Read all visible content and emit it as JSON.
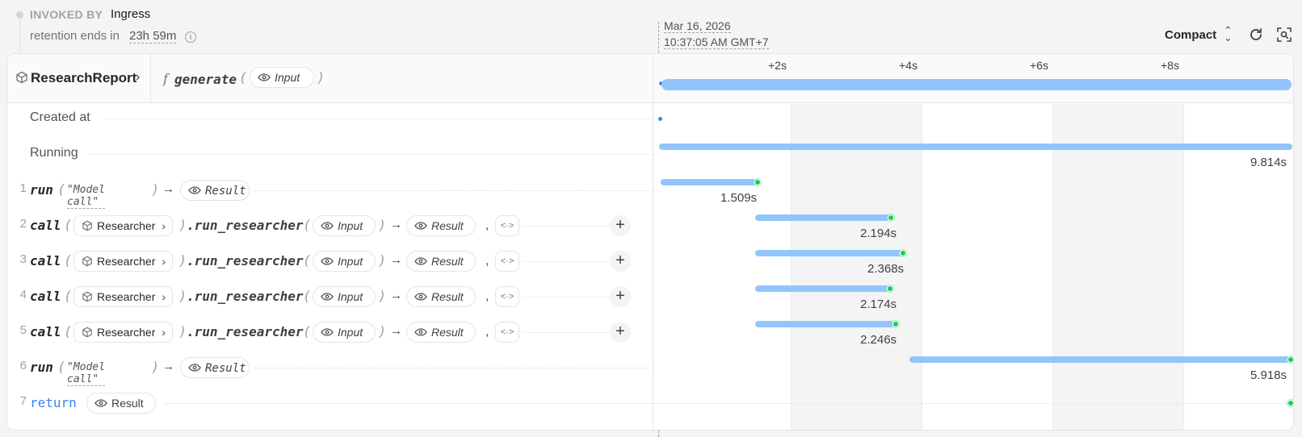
{
  "header": {
    "invoked_by_label": "INVOKED BY",
    "invoked_by_value": "Ingress",
    "retention_label": "retention ends in",
    "retention_value": "23h 59m",
    "date": "Mar 16, 2026",
    "time": "10:37:05 AM GMT+7",
    "view_mode": "Compact"
  },
  "invocation": {
    "service": "ResearchReport",
    "handler": "generate",
    "input_label": "Input"
  },
  "timeline": {
    "ticks": [
      "+2s",
      "+4s",
      "+6s",
      "+8s"
    ]
  },
  "rows": {
    "created_label": "Created at",
    "running_label": "Running",
    "running_duration": "9.814s"
  },
  "entries": [
    {
      "num": "1",
      "kw": "run",
      "arg": "\"Model call\"",
      "result": "Result",
      "duration": "1.509s"
    },
    {
      "num": "2",
      "kw": "call",
      "target": "Researcher",
      "method": ".run_researcher",
      "input": "Input",
      "result": "Result",
      "duration": "2.194s"
    },
    {
      "num": "3",
      "kw": "call",
      "target": "Researcher",
      "method": ".run_researcher",
      "input": "Input",
      "result": "Result",
      "duration": "2.368s"
    },
    {
      "num": "4",
      "kw": "call",
      "target": "Researcher",
      "method": ".run_researcher",
      "input": "Input",
      "result": "Result",
      "duration": "2.174s"
    },
    {
      "num": "5",
      "kw": "call",
      "target": "Researcher",
      "method": ".run_researcher",
      "input": "Input",
      "result": "Result",
      "duration": "2.246s"
    },
    {
      "num": "6",
      "kw": "run",
      "arg": "\"Model call\"",
      "result": "Result",
      "duration": "5.918s"
    },
    {
      "num": "7",
      "kw": "return",
      "result": "Result"
    }
  ],
  "colors": {
    "bar": "#93c5fd",
    "start_dot": "#3b82f6",
    "done_dot": "#22c55e",
    "return_kw": "#3b82f6"
  }
}
